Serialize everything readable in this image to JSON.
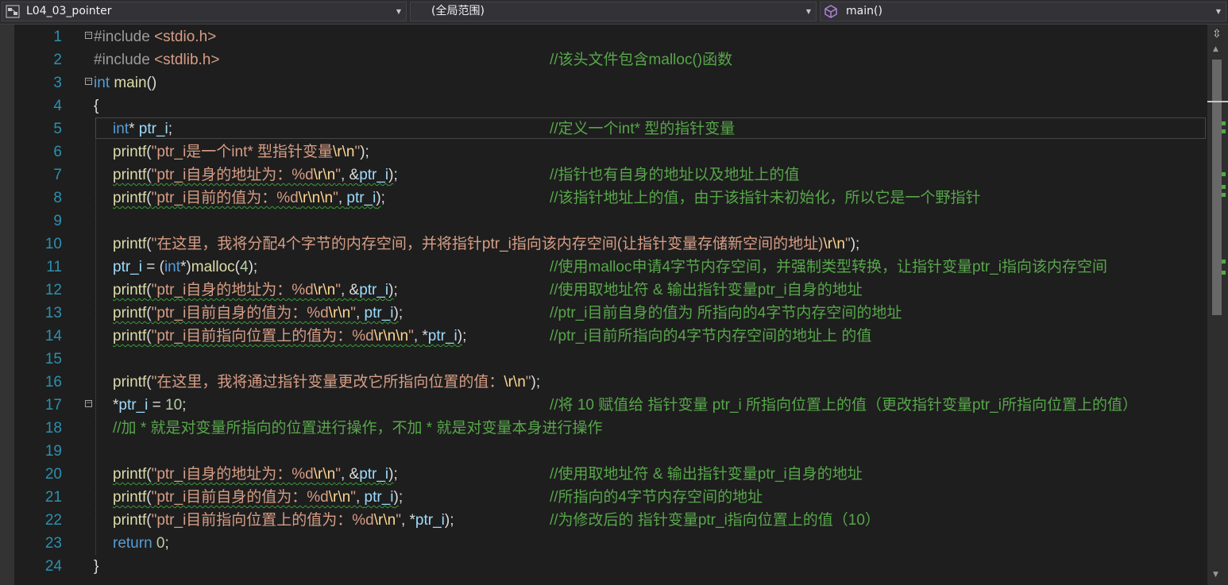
{
  "navbar": {
    "project": "L04_03_pointer",
    "scope": "(全局范围)",
    "member": "main()"
  },
  "lines": [
    {
      "n": "1",
      "code": "<span class='pp'>#include </span><span class='str'>&lt;stdio.h&gt;</span>",
      "comment": ""
    },
    {
      "n": "2",
      "code": "<span class='pp'>#include </span><span class='str'>&lt;stdlib.h&gt;</span>",
      "comment": "//该头文件包含malloc()函数"
    },
    {
      "n": "3",
      "code": "<span class='kw'>int</span> <span class='fn'>main</span>()",
      "comment": ""
    },
    {
      "n": "4",
      "code": "{",
      "comment": ""
    },
    {
      "n": "5",
      "code": "<span class='ind'><span class='kw'>int</span>* <span class='var'>ptr_i</span>;</span>",
      "comment": "//定义一个int* 型的指针变量"
    },
    {
      "n": "6",
      "code": "<span class='ind'><span class='fn'>printf</span>(<span class='str'>\"ptr_i是一个int* 型指针变量<span class='esc'>\\r\\n</span>\"</span>);</span>",
      "comment": ""
    },
    {
      "n": "7",
      "code": "<span class='ind'><span class='fn sq'>printf</span><span class='sq'>(<span class='str'>\"ptr_i自身的地址为：%d<span class='esc'>\\r\\n</span>\"</span>, &amp;<span class='var'>ptr_i</span>)</span>;</span>",
      "comment": "//指针也有自身的地址以及地址上的值"
    },
    {
      "n": "8",
      "code": "<span class='ind'><span class='fn sq'>printf</span><span class='sq'>(<span class='str'>\"ptr_i目前的值为：%d<span class='esc'>\\r\\n\\n</span>\"</span>, <span class='var'>ptr_i</span>)</span>;</span>",
      "comment": "//该指针地址上的值，由于该指针未初始化，所以它是一个野指针"
    },
    {
      "n": "9",
      "code": "",
      "comment": ""
    },
    {
      "n": "10",
      "code": "<span class='ind'><span class='fn'>printf</span>(<span class='str'>\"在这里，我将分配4个字节的内存空间，并将指针ptr_i指向该内存空间(让指针变量存储新空间的地址)<span class='esc'>\\r\\n</span>\"</span>);</span>",
      "comment": ""
    },
    {
      "n": "11",
      "code": "<span class='ind'><span class='var'>ptr_i</span> = (<span class='kw'>int</span>*)<span class='fn'>malloc</span>(<span class='num'>4</span>);</span>",
      "comment": "//使用malloc申请4字节内存空间，并强制类型转换，让指针变量ptr_i指向该内存空间"
    },
    {
      "n": "12",
      "code": "<span class='ind'><span class='fn sq'>printf</span><span class='sq'>(<span class='str'>\"ptr_i自身的地址为：%d<span class='esc'>\\r\\n</span>\"</span>, &amp;<span class='var'>ptr_i</span>)</span>;</span>",
      "comment": "//使用取地址符 &amp; 输出指针变量ptr_i自身的地址"
    },
    {
      "n": "13",
      "code": "<span class='ind'><span class='fn sq'>printf</span><span class='sq'>(<span class='str'>\"ptr_i目前自身的值为：%d<span class='esc'>\\r\\n</span>\"</span>, <span class='var'>ptr_i</span>)</span>;</span>",
      "comment": "//ptr_i目前自身的值为 所指向的4字节内存空间的地址"
    },
    {
      "n": "14",
      "code": "<span class='ind'><span class='fn sq'>printf</span><span class='sq'>(<span class='str'>\"ptr_i目前指向位置上的值为：%d<span class='esc'>\\r\\n\\n</span>\"</span>, *<span class='var'>ptr_i</span>)</span>;</span>",
      "comment": "//ptr_i目前所指向的4字节内存空间的地址上 的值"
    },
    {
      "n": "15",
      "code": "",
      "comment": ""
    },
    {
      "n": "16",
      "code": "<span class='ind'><span class='fn'>printf</span>(<span class='str'>\"在这里，我将通过指针变量更改它所指向位置的值：<span class='esc'>\\r\\n</span>\"</span>);</span>",
      "comment": ""
    },
    {
      "n": "17",
      "code": "<span class='ind'>*<span class='var'>ptr_i</span> = <span class='num'>10</span>;</span>",
      "comment": "//将 10 赋值给 指针变量 ptr_i 所指向位置上的值（更改指针变量ptr_i所指向位置上的值）"
    },
    {
      "n": "18",
      "code": "<span class='ind' style='color:#57a64a'>//加 * 就是对变量所指向的位置进行操作，不加 * 就是对变量本身进行操作</span>",
      "comment": ""
    },
    {
      "n": "19",
      "code": "",
      "comment": ""
    },
    {
      "n": "20",
      "code": "<span class='ind'><span class='fn sq'>printf</span><span class='sq'>(<span class='str'>\"ptr_i自身的地址为：%d<span class='esc'>\\r\\n</span>\"</span>, &amp;<span class='var'>ptr_i</span>)</span>;</span>",
      "comment": "//使用取地址符 &amp; 输出指针变量ptr_i自身的地址"
    },
    {
      "n": "21",
      "code": "<span class='ind'><span class='fn sq'>printf</span><span class='sq'>(<span class='str'>\"ptr_i目前自身的值为：%d<span class='esc'>\\r\\n</span>\"</span>, <span class='var'>ptr_i</span>)</span>;</span>",
      "comment": "//所指向的4字节内存空间的地址"
    },
    {
      "n": "22",
      "code": "<span class='ind'><span class='fn'>printf</span>(<span class='str'>\"ptr_i目前指向位置上的值为：%d<span class='esc'>\\r\\n</span>\"</span>, *<span class='var'>ptr_i</span>);</span>",
      "comment": "//为修改后的 指针变量ptr_i指向位置上的值（10）"
    },
    {
      "n": "23",
      "code": "<span class='ind'><span class='kw'>return</span> <span class='num'>0</span>;</span>",
      "comment": ""
    },
    {
      "n": "24",
      "code": "}",
      "comment": ""
    }
  ]
}
